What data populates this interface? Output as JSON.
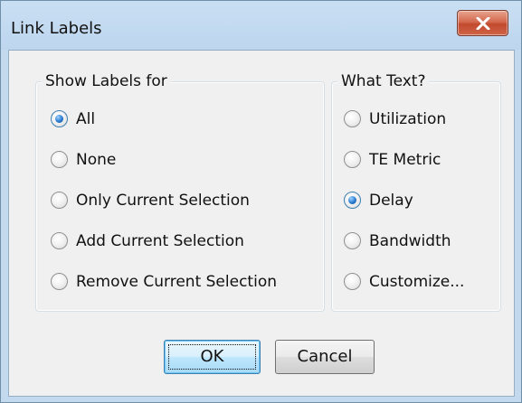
{
  "window": {
    "title": "Link Labels",
    "close_icon": "close-x-icon"
  },
  "show_labels_group": {
    "legend": "Show Labels for",
    "options": [
      {
        "label": "All",
        "checked": true
      },
      {
        "label": "None",
        "checked": false
      },
      {
        "label": "Only Current Selection",
        "checked": false
      },
      {
        "label": "Add Current Selection",
        "checked": false
      },
      {
        "label": "Remove Current Selection",
        "checked": false
      }
    ]
  },
  "what_text_group": {
    "legend": "What Text?",
    "options": [
      {
        "label": "Utilization",
        "checked": false
      },
      {
        "label": "TE Metric",
        "checked": false
      },
      {
        "label": "Delay",
        "checked": true
      },
      {
        "label": "Bandwidth",
        "checked": false
      },
      {
        "label": "Customize...",
        "checked": false
      }
    ]
  },
  "buttons": {
    "ok_label": "OK",
    "cancel_label": "Cancel"
  },
  "colors": {
    "frame": "#c2d9ee",
    "client": "#f0f0f0",
    "close_button": "#c9502f",
    "radio_selected": "#2b7bd0"
  }
}
